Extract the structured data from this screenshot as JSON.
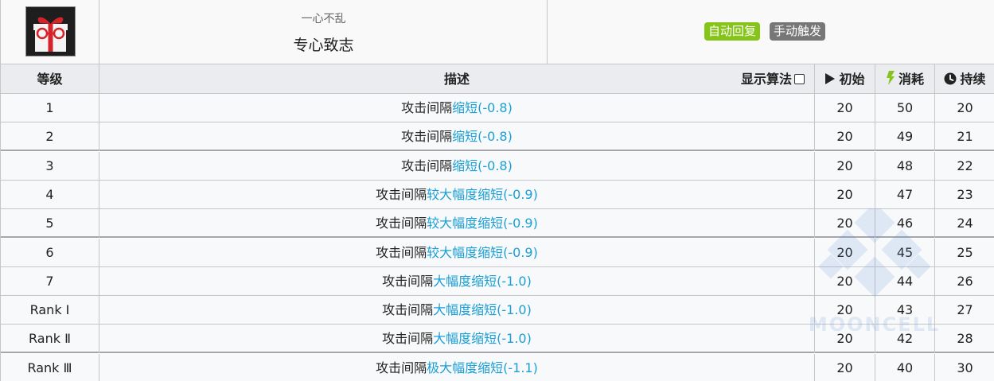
{
  "skill": {
    "icon": "gift-glasses-icon",
    "subname": "一心不乱",
    "name": "专心致志",
    "tags": [
      {
        "label": "自动回复",
        "color": "#86c41a"
      },
      {
        "label": "手动触发",
        "color": "#777777"
      }
    ]
  },
  "columns": {
    "level": "等级",
    "desc": "描述",
    "algo": "显示算法",
    "initial": "初始",
    "cost": "消耗",
    "duration": "持续",
    "initial_icon": "play-icon",
    "cost_icon": "lightning-icon",
    "duration_icon": "clock-icon"
  },
  "rows": [
    {
      "level": "1",
      "desc_prefix": "攻击间隔",
      "desc_highlight": "缩短(-0.8)",
      "initial": "20",
      "cost": "50",
      "duration": "20"
    },
    {
      "level": "2",
      "desc_prefix": "攻击间隔",
      "desc_highlight": "缩短(-0.8)",
      "initial": "20",
      "cost": "49",
      "duration": "21"
    },
    {
      "level": "3",
      "desc_prefix": "攻击间隔",
      "desc_highlight": "缩短(-0.8)",
      "initial": "20",
      "cost": "48",
      "duration": "22"
    },
    {
      "level": "4",
      "desc_prefix": "攻击间隔",
      "desc_highlight": "较大幅度缩短(-0.9)",
      "initial": "20",
      "cost": "47",
      "duration": "23"
    },
    {
      "level": "5",
      "desc_prefix": "攻击间隔",
      "desc_highlight": "较大幅度缩短(-0.9)",
      "initial": "20",
      "cost": "46",
      "duration": "24"
    },
    {
      "level": "6",
      "desc_prefix": "攻击间隔",
      "desc_highlight": "较大幅度缩短(-0.9)",
      "initial": "20",
      "cost": "45",
      "duration": "25"
    },
    {
      "level": "7",
      "desc_prefix": "攻击间隔",
      "desc_highlight": "大幅度缩短(-1.0)",
      "initial": "20",
      "cost": "44",
      "duration": "26"
    },
    {
      "level": "Rank Ⅰ",
      "desc_prefix": "攻击间隔",
      "desc_highlight": "大幅度缩短(-1.0)",
      "initial": "20",
      "cost": "43",
      "duration": "27"
    },
    {
      "level": "Rank Ⅱ",
      "desc_prefix": "攻击间隔",
      "desc_highlight": "大幅度缩短(-1.0)",
      "initial": "20",
      "cost": "42",
      "duration": "28"
    },
    {
      "level": "Rank Ⅲ",
      "desc_prefix": "攻击间隔",
      "desc_highlight": "极大幅度缩短(-1.1)",
      "initial": "20",
      "cost": "40",
      "duration": "30"
    }
  ],
  "colors": {
    "highlight": "#1a9fd6",
    "header_bg": "#eaecf0",
    "row_bg": "#f8f9fa",
    "border": "#c6c6c9"
  },
  "watermark": {
    "text": "MOONCELL",
    "icon": "mooncell-logo-icon"
  }
}
